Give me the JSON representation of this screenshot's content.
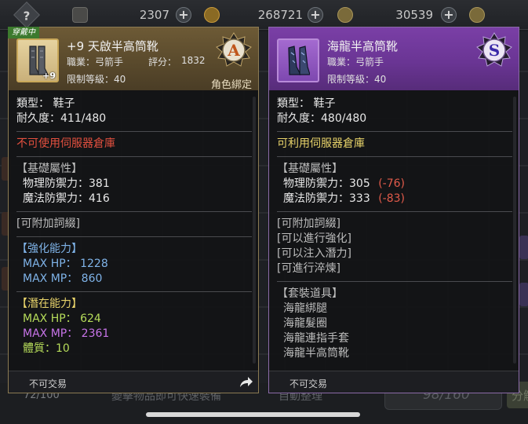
{
  "topbar": {
    "help_glyph": "?",
    "currency1": "2307",
    "currency2": "268721",
    "currency3": "30539",
    "plus_glyph": "+"
  },
  "background": {
    "slot_count": "72/100",
    "hint_text": "變擊物品即可快速裝備",
    "auto_text": "自動整理",
    "capacity": "98/160",
    "right_button": "分解"
  },
  "left_card": {
    "equipped_tag": "穿戴中",
    "enhance_badge": "+9",
    "name": "+9 天啟半高筒靴",
    "job_label": "職業：弓箭手",
    "score_label": "評分：",
    "score_value": "1832",
    "level_label": "限制等級：40",
    "grade": "A",
    "bound": "角色綁定",
    "type_line": "類型：   鞋子",
    "durability_line": "耐久度：411/480",
    "storage_line": "不可使用伺服器倉庫",
    "base_header": "【基礎屬性】",
    "phys_def": "物理防禦力：381",
    "mag_def": "魔法防禦力：416",
    "attachable": "[可附加詞綴]",
    "enh_header": "【強化能力】",
    "enh_hp": "MAX HP：   1228",
    "enh_mp": "MAX MP：    860",
    "pot_header": "【潛在能力】",
    "pot_hp": "MAX HP：   624",
    "pot_mp": "MAX MP：   2361",
    "pot_extra": "體質：10",
    "footer": "不可交易"
  },
  "right_card": {
    "name": "海龍半高筒靴",
    "job_label": "職業：弓箭手",
    "level_label": "限制等級：40",
    "grade": "S",
    "type_line": "類型：   鞋子",
    "durability_line": "耐久度：480/480",
    "storage_line": "可利用伺服器倉庫",
    "base_header": "【基礎屬性】",
    "phys_def": "物理防禦力：305",
    "phys_diff": "(-76)",
    "mag_def": "魔法防禦力：333",
    "mag_diff": "(-83)",
    "attachable": "[可附加詞綴]",
    "can_enhance": "[可以進行強化]",
    "can_inject": "[可以注入潛力]",
    "can_refine": "[可進行淬煉]",
    "set_header": "【套裝道具】",
    "set_items": [
      "海龍綁腿",
      "海龍髮圈",
      "海龍連指手套",
      "海龍半高筒靴"
    ],
    "footer": "不可交易"
  },
  "colors": {
    "left_header": "#6d5a36",
    "right_header": "#7a3fa6",
    "warning_red": "#e3503f",
    "ok_yellow": "#e8d36a",
    "enhance_blue": "#7fb3e8",
    "potential_green": "#b6dc5a",
    "potential_purple": "#c774e8",
    "diff_red": "#e05a4a"
  },
  "icons": [
    "help-icon",
    "ticket-icon",
    "plus-icon",
    "cycle-icon",
    "coin-icon",
    "boot-icon",
    "grade-a-emblem",
    "grade-s-emblem",
    "share-icon"
  ]
}
